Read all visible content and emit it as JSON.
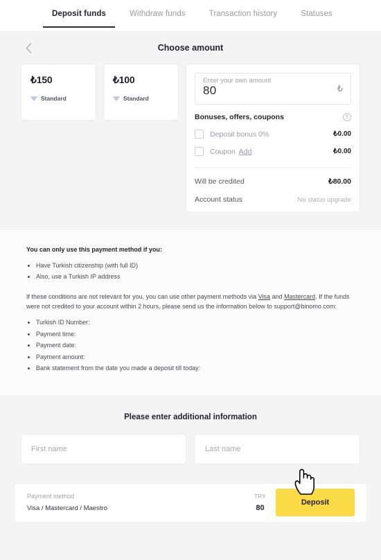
{
  "tabs": [
    {
      "label": "Deposit funds",
      "active": true
    },
    {
      "label": "Withdraw funds",
      "active": false
    },
    {
      "label": "Transaction history",
      "active": false
    },
    {
      "label": "Statuses",
      "active": false
    }
  ],
  "header": {
    "title": "Choose amount",
    "back_icon": "chevron-left-icon"
  },
  "amount_cards": [
    {
      "value": "₺150",
      "badge": "Standard",
      "badge_icon": "gem-icon"
    },
    {
      "value": "₺100",
      "badge": "Standard",
      "badge_icon": "gem-icon"
    }
  ],
  "own_amount": {
    "placeholder": "Enter your own amount",
    "value": "80",
    "currency_symbol": "₺"
  },
  "bonuses": {
    "title": "Bonuses, offers, coupons",
    "info_icon": "info-exclamation-icon",
    "rows": [
      {
        "label": "Deposit bonus 0%",
        "amount": "₺0.00",
        "checked": false,
        "link": ""
      },
      {
        "label": "Coupon",
        "amount": "₺0.00",
        "checked": false,
        "link": "Add"
      }
    ]
  },
  "summary": [
    {
      "label": "Will be credited",
      "value": "₺80.00",
      "muted": false
    },
    {
      "label": "Account status",
      "value": "No status upgrade",
      "muted": true
    }
  ],
  "info": {
    "heading": "You can only use this payment method if you:",
    "conditions": [
      "Have Turkish citizenship (with full ID)",
      "Also, use a Turkish IP address"
    ],
    "para_1a": "If these conditions are not relevant for you, you can use other payment methods via ",
    "link_visa": "Visa",
    "para_1b": " and ",
    "link_mastercard": "Mastercard",
    "para_1c": ". If the funds were not credited to your account within 2 hours, please send us the information below to support@binomo.com:",
    "requirements": [
      "Turkish ID Number:",
      "Payment time:",
      "Payment date:",
      "Payment amount:",
      "Bank statement from the date you made a deposit till today:"
    ]
  },
  "additional": {
    "title": "Please enter additional information",
    "first_name_placeholder": "First name",
    "first_name_value": "",
    "last_name_placeholder": "Last name",
    "last_name_value": ""
  },
  "payment_bar": {
    "method_label": "Payment method",
    "method_value": "Visa / Mastercard / Maestro",
    "currency_label": "TRY",
    "amount": "80",
    "deposit_label": "Deposit",
    "cursor_icon": "pointing-hand-cursor"
  },
  "colors": {
    "accent_yellow": "#FBDA47",
    "page_bg": "#F4F4F4",
    "text_dark": "#23232B",
    "text_muted": "#9C9CA5"
  }
}
